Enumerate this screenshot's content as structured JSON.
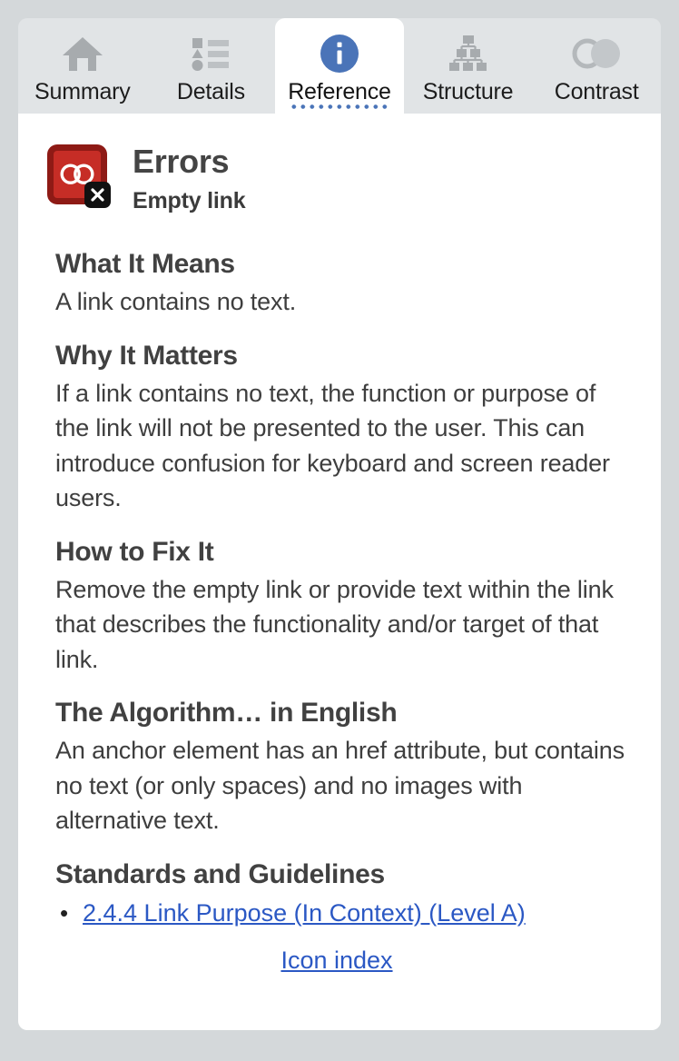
{
  "window": {
    "background_color": "#d4d8da",
    "panel_color": "#ffffff",
    "tabbar_color": "#e1e4e6"
  },
  "tabs": [
    {
      "id": "summary",
      "label": "Summary",
      "icon": "home-icon",
      "active": false
    },
    {
      "id": "details",
      "label": "Details",
      "icon": "list-icon",
      "active": false
    },
    {
      "id": "reference",
      "label": "Reference",
      "icon": "info-icon",
      "active": true
    },
    {
      "id": "structure",
      "label": "Structure",
      "icon": "hierarchy-icon",
      "active": false
    },
    {
      "id": "contrast",
      "label": "Contrast",
      "icon": "contrast-icon",
      "active": false
    }
  ],
  "reference": {
    "icon": {
      "name": "empty-link-error-icon",
      "glyph": "chain-link-icon",
      "badge": "x-badge-icon",
      "outer_color": "#8e1a15",
      "inner_color": "#c62d26",
      "badge_color": "#111111"
    },
    "category": "Errors",
    "rule_name": "Empty link",
    "sections": [
      {
        "heading": "What It Means",
        "body": "A link contains no text."
      },
      {
        "heading": "Why It Matters",
        "body": "If a link contains no text, the function or purpose of the link will not be presented to the user. This can introduce confusion for keyboard and screen reader users."
      },
      {
        "heading": "How to Fix It",
        "body": "Remove the empty link or provide text within the link that describes the functionality and/or target of that link."
      },
      {
        "heading": "The Algorithm… in English",
        "body": "An anchor element has an href attribute, but contains no text (or only spaces) and no images with alternative text."
      }
    ],
    "standards": {
      "heading": "Standards and Guidelines",
      "items": [
        "2.4.4 Link Purpose (In Context) (Level A)"
      ]
    },
    "icon_index_label": "Icon index",
    "link_color": "#2b58c4"
  }
}
